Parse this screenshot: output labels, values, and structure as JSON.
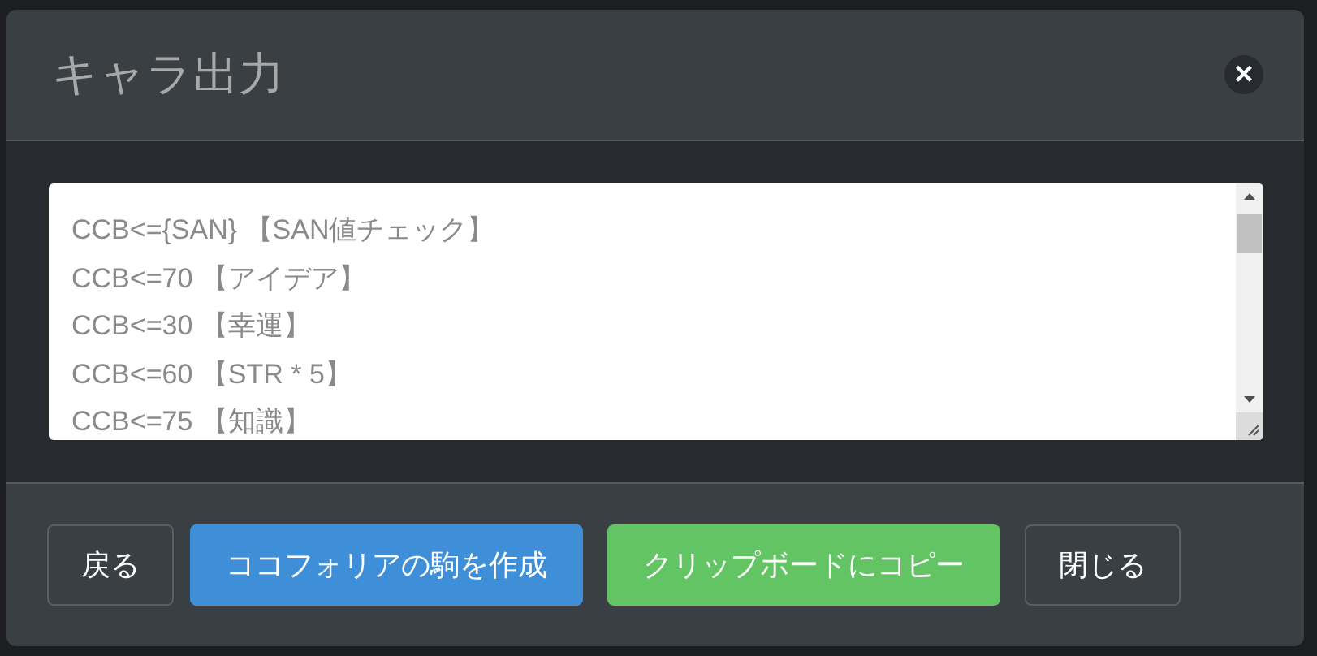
{
  "dialog": {
    "title": "キャラ出力",
    "close_label": "×"
  },
  "output": {
    "lines": [
      "CCB<={SAN} 【SAN値チェック】",
      "CCB<=70 【アイデア】",
      "CCB<=30 【幸運】",
      "CCB<=60 【STR * 5】",
      "CCB<=75 【知識】"
    ]
  },
  "buttons": [
    {
      "label": "戻る",
      "kind": "default"
    },
    {
      "label": "ココフォリアの駒を作成",
      "kind": "primary"
    },
    {
      "label": "クリップボードにコピー",
      "kind": "success"
    },
    {
      "label": "閉じる",
      "kind": "default"
    }
  ]
}
